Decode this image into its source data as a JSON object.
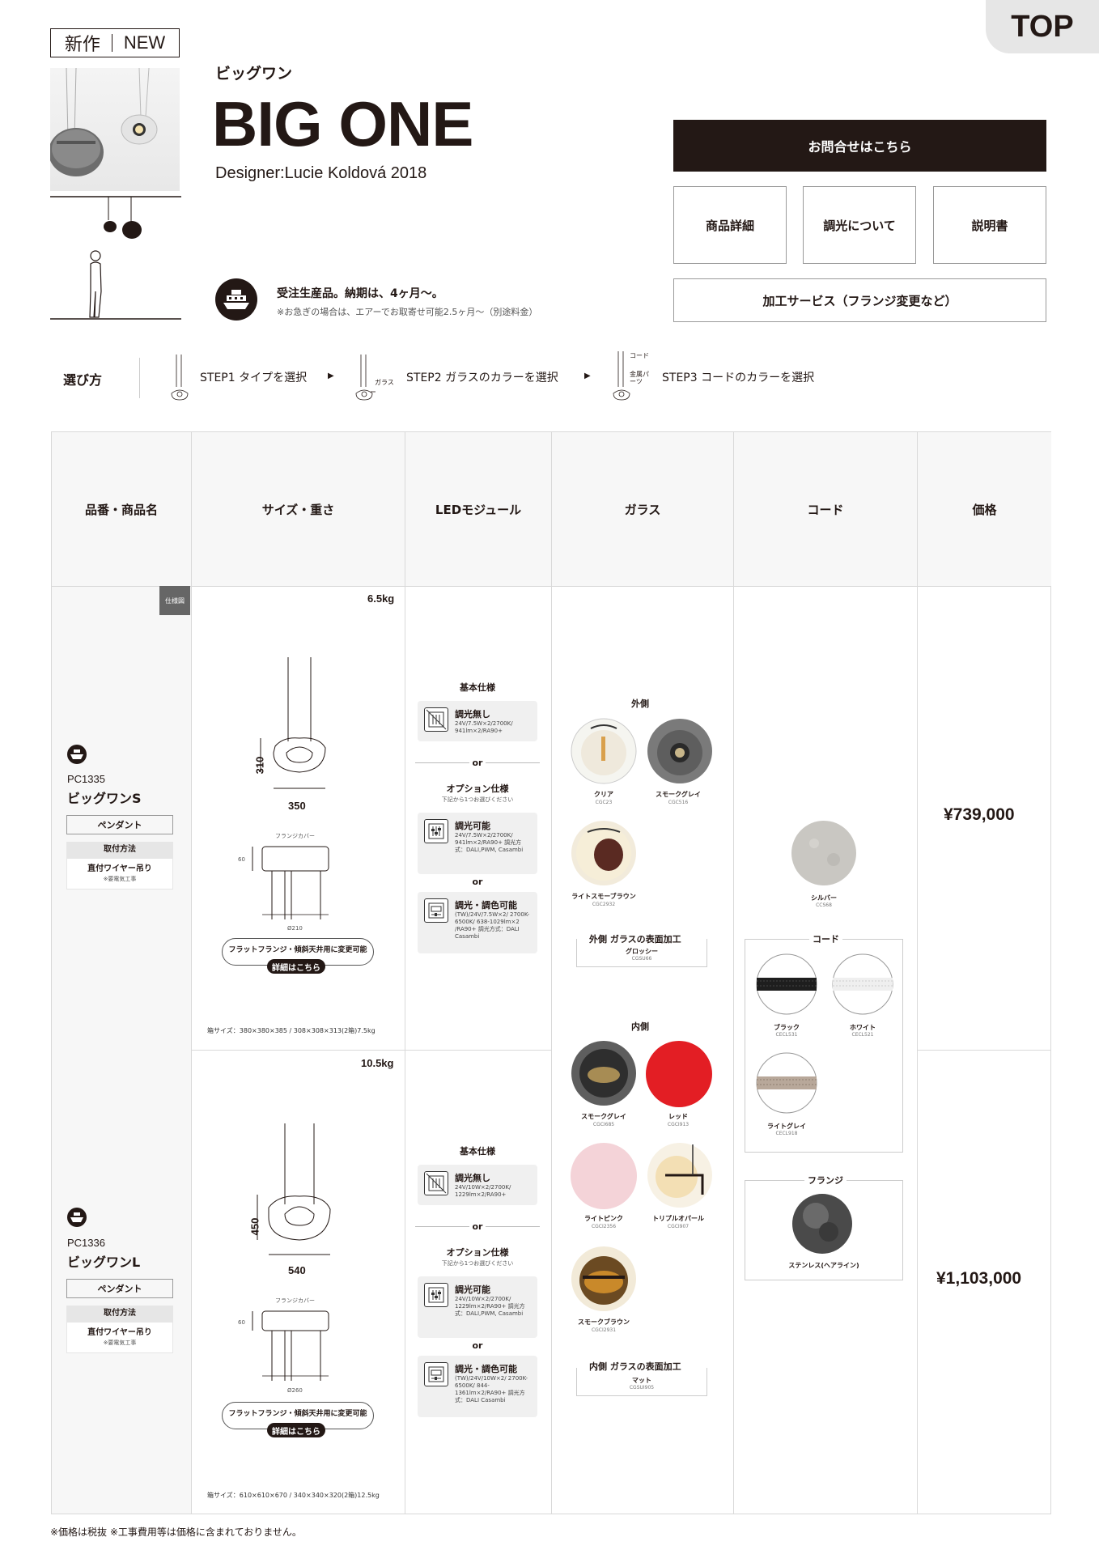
{
  "header": {
    "top_link": "TOP",
    "badge_ja": "新作",
    "badge_en": "NEW",
    "name_ja": "ビッグワン",
    "name_en": "BIG ONE",
    "designer": "Designer:Lucie Koldová 2018",
    "order_note": "受注生産品。納期は、4ヶ月〜。",
    "order_sub": "※お急ぎの場合は、エアーでお取寄せ可能2.5ヶ月〜（別途料金）"
  },
  "buttons": {
    "contact": "お問合せはこちら",
    "detail": "商品詳細",
    "dimming": "調光について",
    "manual": "説明書",
    "service": "加工サービス（フランジ変更など）"
  },
  "steps": {
    "title": "選び方",
    "step1": "STEP1 タイプを選択",
    "step2": "STEP2 ガラスのカラーを選択",
    "step3": "STEP3 コードのカラーを選択",
    "tag_glass": "ガラス",
    "tag_cord": "コード",
    "tag_metal": "金属パーツ",
    "arrow": "▶"
  },
  "table": {
    "headers": [
      "品番・商品名",
      "サイズ・重さ",
      "LEDモジュール",
      "ガラス",
      "コード",
      "価格"
    ],
    "spec_tag": "仕様図",
    "products": [
      {
        "code": "PC1335",
        "name": "ビッグワンS",
        "type": "ペンダント",
        "mount_title": "取付方法",
        "mount": "直付ワイヤー吊り",
        "mount_note": "※要電気工事",
        "weight": "6.5kg",
        "height": "310",
        "width": "350",
        "flange_cover": "フランジカバー",
        "flange_h": "60",
        "flange_d": "Ø210",
        "flange_pill": "フラットフランジ・傾斜天井用に変更可能",
        "detail_pill": "詳細はこちら",
        "box_size": "箱サイズ：380×380×385 / 308×308×313(2箱)7.5kg",
        "price": "¥739,000",
        "led": {
          "basic_title": "基本仕様",
          "basic_name": "調光無し",
          "basic_desc": "24V/7.5W×2/2700K/ 941lm×2/RA90+",
          "or": "or",
          "option_title": "オプション仕様",
          "option_sub": "下記から1つお選びください",
          "opt1_name": "調光可能",
          "opt1_desc": "24V/7.5W×2/2700K/ 941lm×2/RA90+ 調光方式：DALI,PWM, Casambi",
          "opt2_name": "調光・調色可能",
          "opt2_desc": "(TW)/24V/7.5W×2/ 2700K-6500K/ 638-1029lm×2 /RA90+ 調光方式：DALI Casambi"
        }
      },
      {
        "code": "PC1336",
        "name": "ビッグワンL",
        "type": "ペンダント",
        "mount_title": "取付方法",
        "mount": "直付ワイヤー吊り",
        "mount_note": "※要電気工事",
        "weight": "10.5kg",
        "height": "450",
        "width": "540",
        "flange_cover": "フランジカバー",
        "flange_h": "60",
        "flange_d": "Ø260",
        "flange_pill": "フラットフランジ・傾斜天井用に変更可能",
        "detail_pill": "詳細はこちら",
        "box_size": "箱サイズ：610×610×670 / 340×340×320(2箱)12.5kg",
        "price": "¥1,103,000",
        "led": {
          "basic_title": "基本仕様",
          "basic_name": "調光無し",
          "basic_desc": "24V/10W×2/2700K/ 1229lm×2/RA90+",
          "or": "or",
          "option_title": "オプション仕様",
          "option_sub": "下記から1つお選びください",
          "opt1_name": "調光可能",
          "opt1_desc": "24V/10W×2/2700K/ 1229lm×2/RA90+ 調光方式：DALI,PWM, Casambi",
          "opt2_name": "調光・調色可能",
          "opt2_desc": "(TW)/24V/10W×2/ 2700K-6500K/ 844-1361lm×2/RA90+ 調光方式：DALI Casambi"
        }
      }
    ],
    "glass": {
      "outer_title": "外側",
      "outer": [
        {
          "name": "クリア",
          "code": "CGC23"
        },
        {
          "name": "スモークグレイ",
          "code": "CGC516"
        },
        {
          "name": "ライトスモーブラウン",
          "code": "CGC2932"
        }
      ],
      "outer_finish_title": "外側 ガラスの表面加工",
      "outer_finish": "グロッシー",
      "outer_finish_code": "CGSU66",
      "inner_title": "内側",
      "inner": [
        {
          "name": "スモークグレイ",
          "code": "CGCI685"
        },
        {
          "name": "レッド",
          "code": "CGCI913"
        },
        {
          "name": "ライトピンク",
          "code": "CGCI2356"
        },
        {
          "name": "トリプルオパール",
          "code": "CGCI907"
        },
        {
          "name": "スモークブラウン",
          "code": "CGCI2931"
        }
      ],
      "inner_finish_title": "内側 ガラスの表面加工",
      "inner_finish": "マット",
      "inner_finish_code": "CGSUI905"
    },
    "cord": {
      "silver": {
        "name": "シルバー",
        "code": "CCS68"
      },
      "cord_title": "コード",
      "cords": [
        {
          "name": "ブラック",
          "code": "CECL531"
        },
        {
          "name": "ホワイト",
          "code": "CECL521"
        },
        {
          "name": "ライトグレイ",
          "code": "CECL918"
        }
      ],
      "flange_title": "フランジ",
      "flange": {
        "name": "ステンレス(ヘアライン)"
      }
    }
  },
  "footer": "※価格は税抜 ※工事費用等は価格に含まれておりません。",
  "colors": {
    "dark": "#231815",
    "red": "#e31e24",
    "pink": "#f4d3d8"
  }
}
